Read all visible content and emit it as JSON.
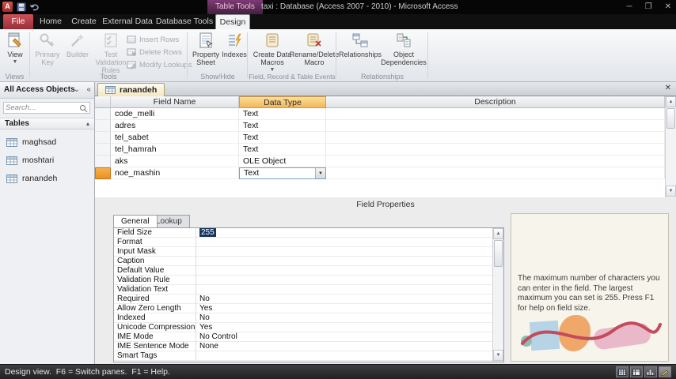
{
  "titlebar": {
    "contextual_group": "Table Tools",
    "title": "taxi : Database (Access 2007 - 2010) - Microsoft Access"
  },
  "ribbon": {
    "file_tab": "File",
    "tabs": [
      "Home",
      "Create",
      "External Data",
      "Database Tools"
    ],
    "active_tab": "Design",
    "groups": {
      "views": {
        "label": "Views",
        "view_button": "View"
      },
      "tools": {
        "label": "Tools",
        "primary_key": "Primary Key",
        "builder": "Builder",
        "test_validation": "Test Validation Rules",
        "insert_rows": "Insert Rows",
        "delete_rows": "Delete Rows",
        "modify_lookups": "Modify Lookups"
      },
      "show_hide": {
        "label": "Show/Hide",
        "property_sheet": "Property Sheet",
        "indexes": "Indexes"
      },
      "events": {
        "label": "Field, Record & Table Events",
        "create_data_macros": "Create Data Macros",
        "rename_delete_macro": "Rename/Delete Macro"
      },
      "relationships": {
        "label": "Relationships",
        "relationships": "Relationships",
        "object_dependencies": "Object Dependencies"
      }
    }
  },
  "navpane": {
    "header": "All Access Objects",
    "search_placeholder": "Search...",
    "group": "Tables",
    "items": [
      "maghsad",
      "moshtari",
      "ranandeh"
    ]
  },
  "document": {
    "tab": "ranandeh",
    "grid": {
      "headers": [
        "Field Name",
        "Data Type",
        "Description"
      ],
      "rows": [
        {
          "name": "code_melli",
          "type": "Text"
        },
        {
          "name": "adres",
          "type": "Text"
        },
        {
          "name": "tel_sabet",
          "type": "Text"
        },
        {
          "name": "tel_hamrah",
          "type": "Text"
        },
        {
          "name": "aks",
          "type": "OLE Object"
        },
        {
          "name": "noe_mashin",
          "type": "Text"
        }
      ]
    },
    "field_properties_label": "Field Properties",
    "property_tabs": [
      "General",
      "Lookup"
    ],
    "properties": [
      {
        "name": "Field Size",
        "value": "255"
      },
      {
        "name": "Format",
        "value": ""
      },
      {
        "name": "Input Mask",
        "value": ""
      },
      {
        "name": "Caption",
        "value": ""
      },
      {
        "name": "Default Value",
        "value": ""
      },
      {
        "name": "Validation Rule",
        "value": ""
      },
      {
        "name": "Validation Text",
        "value": ""
      },
      {
        "name": "Required",
        "value": "No"
      },
      {
        "name": "Allow Zero Length",
        "value": "Yes"
      },
      {
        "name": "Indexed",
        "value": "No"
      },
      {
        "name": "Unicode Compression",
        "value": "Yes"
      },
      {
        "name": "IME Mode",
        "value": "No Control"
      },
      {
        "name": "IME Sentence Mode",
        "value": "None"
      },
      {
        "name": "Smart Tags",
        "value": ""
      }
    ],
    "help_text": "The maximum number of characters you can enter in the field. The largest maximum you can set is 255. Press F1 for help on field size."
  },
  "statusbar": {
    "text": "Design view.  F6 = Switch panes.  F1 = Help."
  },
  "colors": {
    "file_tab_red": "#b03a41",
    "contextual_pink": "#7e3a74",
    "selected_header_orange": "#f3b65a",
    "selection_navy": "#16365c"
  }
}
